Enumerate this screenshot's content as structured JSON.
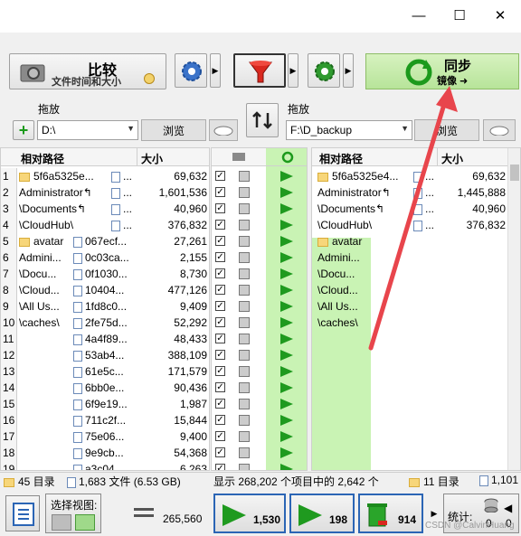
{
  "window": {
    "minimize": "—",
    "maximize": "☐",
    "close": "✕"
  },
  "toolbar": {
    "compare_title": "比较",
    "compare_sub": "文件时间和大小",
    "sync_title": "同步",
    "sync_sub": "镜像 ➜"
  },
  "left_path": {
    "drag_label": "拖放",
    "value": "D:\\",
    "browse": "浏览"
  },
  "right_path": {
    "drag_label": "拖放",
    "value": "F:\\D_backup",
    "browse": "浏览"
  },
  "headers": {
    "left_path": "相对路径",
    "left_size": "大小",
    "right_path": "相对路径",
    "right_size": "大小"
  },
  "rows": [
    {
      "n": "1",
      "lp": "5f6a5325e...",
      "lf": "...",
      "ls": "69,632",
      "rp": "5f6a5325e4...",
      "rf": "...",
      "rs": "69,632"
    },
    {
      "n": "2",
      "lp": "Administrator↰",
      "lf": "...",
      "ls": "1,601,536",
      "rp": "Administrator↰",
      "rf": "...",
      "rs": "1,445,888"
    },
    {
      "n": "3",
      "lp": "\\Documents↰",
      "lf": "...",
      "ls": "40,960",
      "rp": "\\Documents↰",
      "rf": "...",
      "rs": "40,960"
    },
    {
      "n": "4",
      "lp": "\\CloudHub\\",
      "lf": "...",
      "ls": "376,832",
      "rp": "\\CloudHub\\",
      "rf": "...",
      "rs": "376,832"
    },
    {
      "n": "5",
      "lp": "avatar",
      "lf": "067ecf...",
      "ls": "27,261",
      "rp": "avatar",
      "rf": "",
      "rs": ""
    },
    {
      "n": "6",
      "lp": "Admini...",
      "lf": "0c03ca...",
      "ls": "2,155",
      "rp": "Admini...",
      "rf": "",
      "rs": ""
    },
    {
      "n": "7",
      "lp": "\\Docu...",
      "lf": "0f1030...",
      "ls": "8,730",
      "rp": "\\Docu...",
      "rf": "",
      "rs": ""
    },
    {
      "n": "8",
      "lp": "\\Cloud...",
      "lf": "10404...",
      "ls": "477,126",
      "rp": "\\Cloud...",
      "rf": "",
      "rs": ""
    },
    {
      "n": "9",
      "lp": "\\All Us...",
      "lf": "1fd8c0...",
      "ls": "9,409",
      "rp": "\\All Us...",
      "rf": "",
      "rs": ""
    },
    {
      "n": "10",
      "lp": "\\caches\\",
      "lf": "2fe75d...",
      "ls": "52,292",
      "rp": "\\caches\\",
      "rf": "",
      "rs": ""
    },
    {
      "n": "11",
      "lp": "",
      "lf": "4a4f89...",
      "ls": "48,433",
      "rp": "",
      "rf": "",
      "rs": ""
    },
    {
      "n": "12",
      "lp": "",
      "lf": "53ab4...",
      "ls": "388,109",
      "rp": "",
      "rf": "",
      "rs": ""
    },
    {
      "n": "13",
      "lp": "",
      "lf": "61e5c...",
      "ls": "171,579",
      "rp": "",
      "rf": "",
      "rs": ""
    },
    {
      "n": "14",
      "lp": "",
      "lf": "6bb0e...",
      "ls": "90,436",
      "rp": "",
      "rf": "",
      "rs": ""
    },
    {
      "n": "15",
      "lp": "",
      "lf": "6f9e19...",
      "ls": "1,987",
      "rp": "",
      "rf": "",
      "rs": ""
    },
    {
      "n": "16",
      "lp": "",
      "lf": "711c2f...",
      "ls": "15,844",
      "rp": "",
      "rf": "",
      "rs": ""
    },
    {
      "n": "17",
      "lp": "",
      "lf": "75e06...",
      "ls": "9,400",
      "rp": "",
      "rf": "",
      "rs": ""
    },
    {
      "n": "18",
      "lp": "",
      "lf": "9e9cb...",
      "ls": "54,368",
      "rp": "",
      "rf": "",
      "rs": ""
    },
    {
      "n": "19",
      "lp": "",
      "lf": "a3c04...",
      "ls": "6,263",
      "rp": "",
      "rf": "",
      "rs": ""
    }
  ],
  "status": {
    "left_dirs": "45 目录",
    "left_files": "1,683 文件 (6.53 GB)",
    "middle": "显示 268,202 个项目中的 2,642 个",
    "right_dirs": "11 目录",
    "right_files": "1,101"
  },
  "bottom": {
    "select_view": "选择视图:",
    "equal_count": "265,560",
    "create_count": "1,530",
    "update_count": "198",
    "delete_count": "914",
    "stats_label": "统计:",
    "stats_value": "0",
    "stats_value2": "0"
  },
  "watermark": "CSDN @CalvinHuang"
}
